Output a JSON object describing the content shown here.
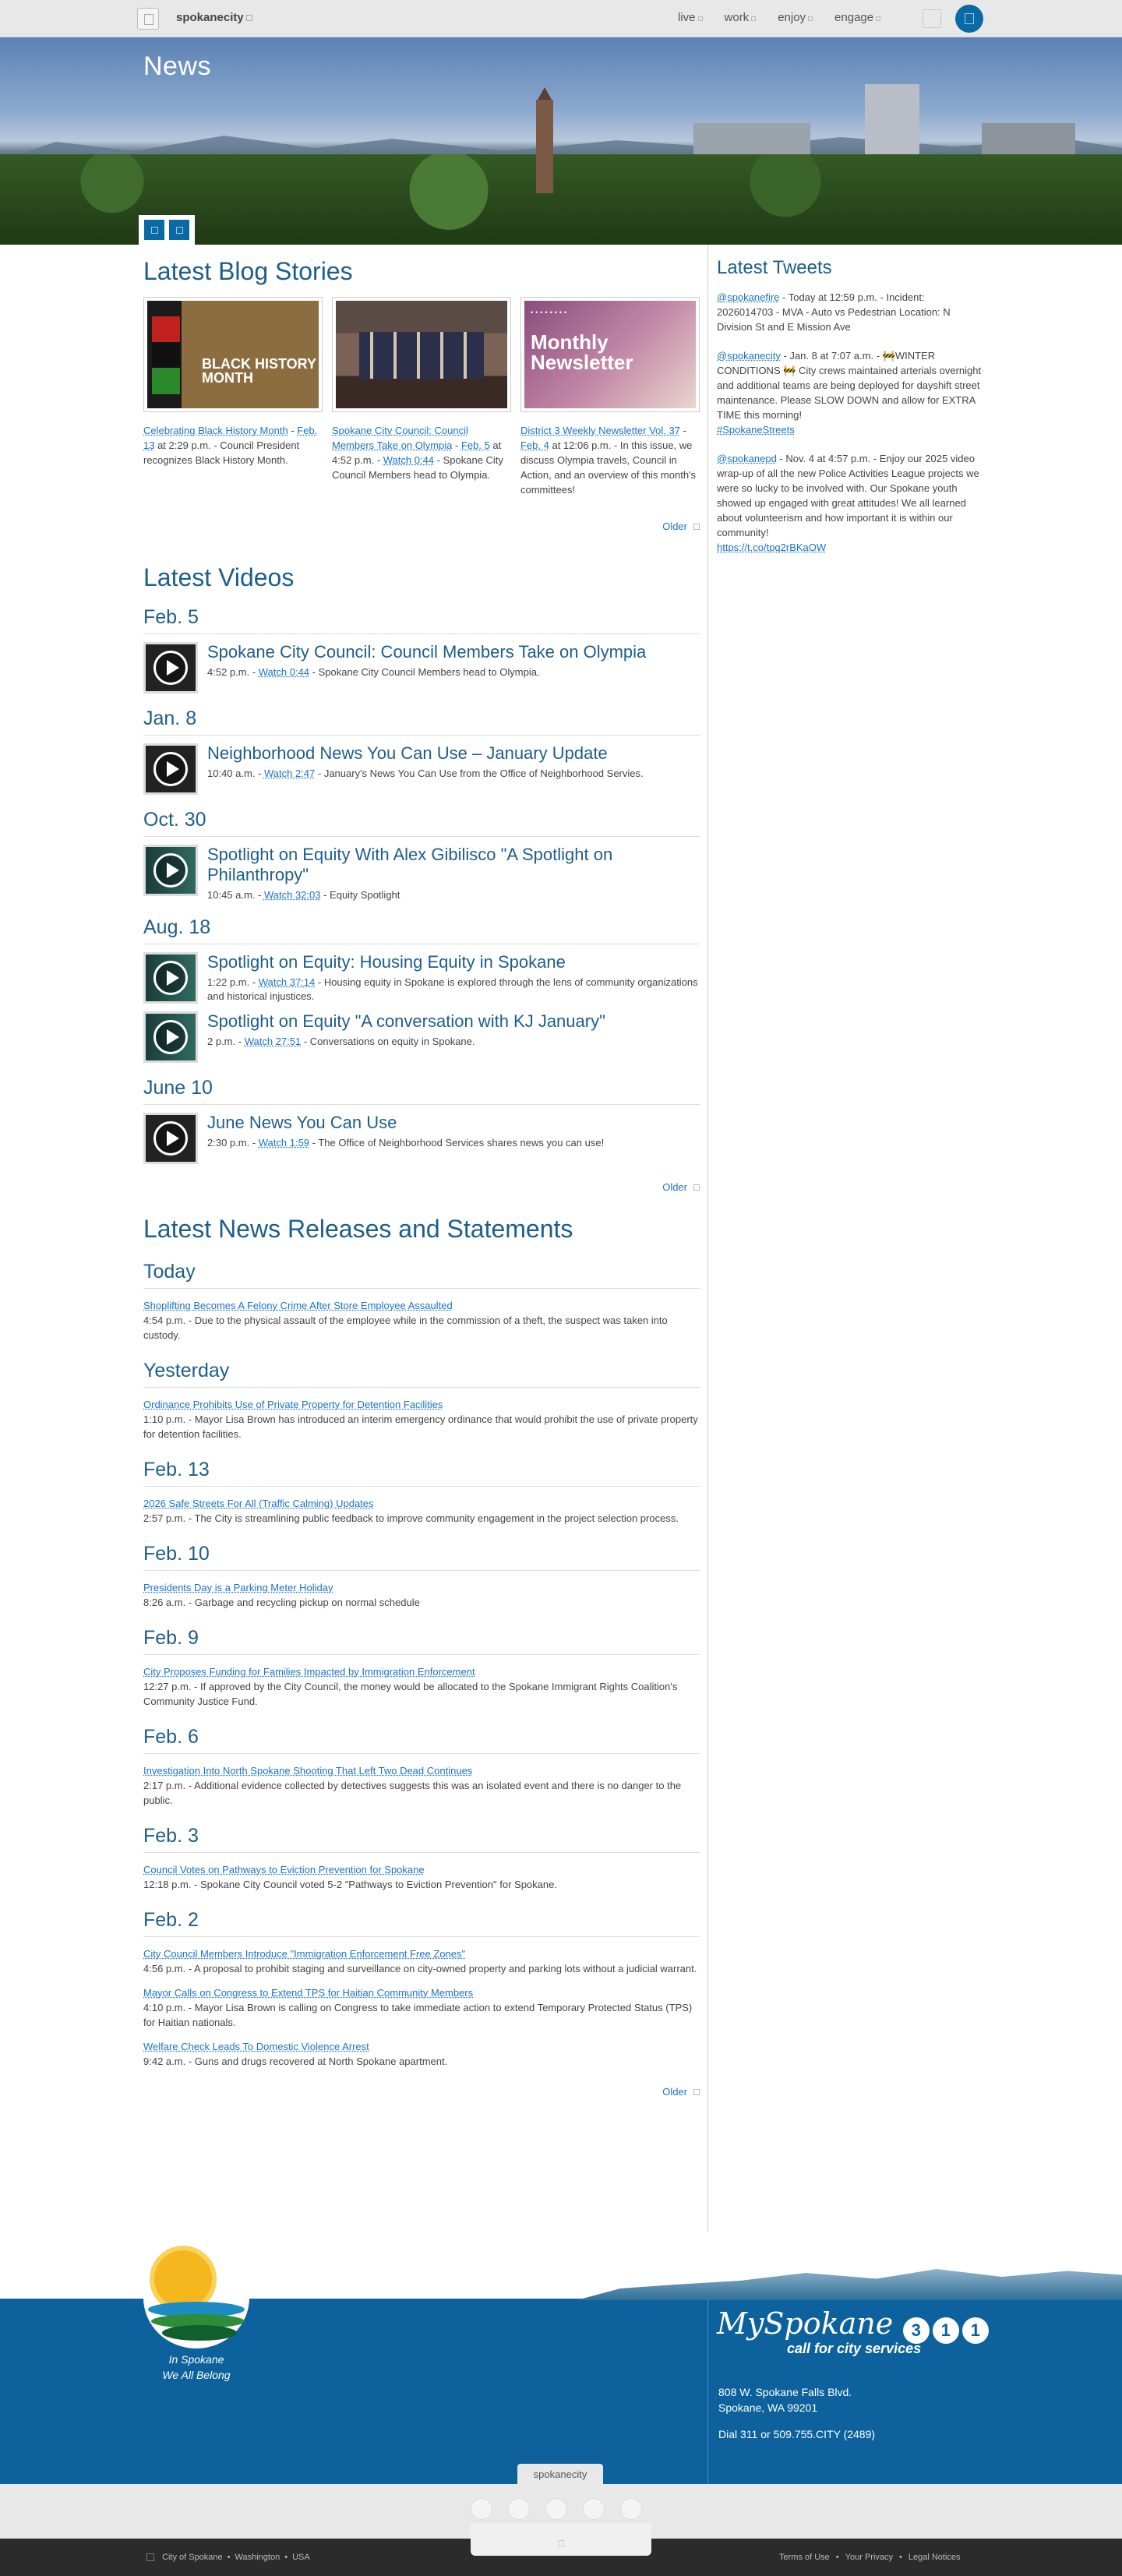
{
  "nav": {
    "brand": "spokanecity",
    "links": [
      "live",
      "work",
      "enjoy",
      "engage"
    ]
  },
  "hero": {
    "title": "News"
  },
  "blog": {
    "heading": "Latest Blog Stories",
    "cards": [
      {
        "image_text": "BLACK HISTORY MONTH",
        "title": "Celebrating Black History Month",
        "date": "Feb. 13",
        "time": " at 2:29 p.m.",
        "desc": " - Council President recognizes Black History Month."
      },
      {
        "image_text": "",
        "title": "Spokane City Council: Council Members Take on Olympia",
        "date": "Feb. 5",
        "time": " at 4:52 p.m.",
        "watch": "Watch 0:44",
        "desc": " - Spokane City Council Members head to Olympia."
      },
      {
        "image_text": "Monthly Newsletter",
        "title": "District 3 Weekly Newsletter Vol. 37",
        "date": "Feb. 4",
        "time": " at 12:06 p.m.",
        "desc": " - In this issue, we discuss Olympia travels, Council in Action, and an overview of this month's committees!"
      }
    ],
    "older": "Older"
  },
  "videos": {
    "heading": "Latest Videos",
    "groups": [
      {
        "date": "Feb. 5",
        "items": [
          {
            "title": "Spokane City Council: Council Members Take on Olympia",
            "time": "4:52 p.m. - ",
            "watch": "Watch 0:44",
            "desc": " - Spokane City Council Members head to Olympia."
          }
        ]
      },
      {
        "date": "Jan. 8",
        "items": [
          {
            "title": "Neighborhood News You Can Use – January Update",
            "time": "10:40 a.m. - ",
            "watch": "Watch 2:47",
            "desc": " - January's News You Can Use from the Office of Neighborhood Servies."
          }
        ]
      },
      {
        "date": "Oct. 30",
        "items": [
          {
            "title": "Spotlight on Equity With Alex Gibilisco \"A Spotlight on Philanthropy\"",
            "time": "10:45 a.m. - ",
            "watch": "Watch 32:03",
            "desc": " - Equity Spotlight"
          }
        ]
      },
      {
        "date": "Aug. 18",
        "items": [
          {
            "title": "Spotlight on Equity: Housing Equity in Spokane",
            "time": "1:22 p.m. - ",
            "watch": "Watch 37:14",
            "desc": " - Housing equity in Spokane is explored through the lens of community organizations and historical injustices."
          },
          {
            "title": "Spotlight on Equity \"A conversation with KJ January\"",
            "time": "2 p.m. - ",
            "watch": "Watch 27:51",
            "desc": " - Conversations on equity in Spokane."
          }
        ]
      },
      {
        "date": "June 10",
        "items": [
          {
            "title": "June News You Can Use",
            "time": "2:30 p.m. - ",
            "watch": "Watch 1:59",
            "desc": " - The Office of Neighborhood Services shares news you can use!"
          }
        ]
      }
    ],
    "older": "Older"
  },
  "news": {
    "heading": "Latest News Releases and Statements",
    "groups": [
      {
        "date": "Today",
        "items": [
          {
            "title": "Shoplifting Becomes A Felony Crime After Store Employee Assaulted",
            "desc": "4:54 p.m. - Due to the physical assault of the employee while in the commission of a theft, the suspect was taken into custody."
          }
        ]
      },
      {
        "date": "Yesterday",
        "items": [
          {
            "title": "Ordinance Prohibits Use of Private Property for Detention Facilities",
            "desc": "1:10 p.m. - Mayor Lisa Brown has introduced an interim emergency ordinance that would prohibit the use of private property for detention facilities."
          }
        ]
      },
      {
        "date": "Feb. 13",
        "items": [
          {
            "title": "2026 Safe Streets For All (Traffic Calming) Updates",
            "desc": "2:57 p.m. - The City is streamlining public feedback to improve community engagement in the project selection process."
          }
        ]
      },
      {
        "date": "Feb. 10",
        "items": [
          {
            "title": "Presidents Day is a Parking Meter Holiday",
            "desc": "8:26 a.m. - Garbage and recycling pickup on normal schedule"
          }
        ]
      },
      {
        "date": "Feb. 9",
        "items": [
          {
            "title": "City Proposes Funding for Families Impacted by Immigration Enforcement",
            "desc": "12:27 p.m. - If approved by the City Council, the money would be allocated to the Spokane Immigrant Rights Coalition's Community Justice Fund."
          }
        ]
      },
      {
        "date": "Feb. 6",
        "items": [
          {
            "title": "Investigation Into North Spokane Shooting That Left Two Dead Continues",
            "desc": "2:17 p.m. - Additional evidence collected by detectives suggests this was an isolated event and there is no danger to the public."
          }
        ]
      },
      {
        "date": "Feb. 3",
        "items": [
          {
            "title": "Council Votes on Pathways to Eviction Prevention for Spokane",
            "desc": "12:18 p.m. - Spokane City Council voted 5-2 \"Pathways to Eviction Prevention\" for Spokane."
          }
        ]
      },
      {
        "date": "Feb. 2",
        "items": [
          {
            "title": "City Council Members Introduce \"Immigration Enforcement Free Zones\"",
            "desc": "4:56 p.m. - A proposal to prohibit staging and surveillance on city-owned property and parking lots without a judicial warrant."
          },
          {
            "title": "Mayor Calls on Congress to Extend TPS for Haitian Community Members",
            "desc": "4:10 p.m. - Mayor Lisa Brown is calling on Congress to take immediate action to extend Temporary Protected Status (TPS) for Haitian nationals."
          },
          {
            "title": "Welfare Check Leads To Domestic Violence Arrest",
            "desc": "9:42 a.m. - Guns and drugs recovered at North Spokane apartment."
          }
        ]
      }
    ],
    "older": "Older"
  },
  "tweets": {
    "heading": "Latest Tweets",
    "items": [
      {
        "handle": "@spokanefire",
        "text": " - Today at 12:59 p.m. - Incident: 2026014703 - MVA - Auto vs Pedestrian Location: N Division St and E Mission Ave"
      },
      {
        "handle": "@spokanecity",
        "text": " - Jan. 8 at 7:07 a.m. - 🚧WINTER CONDITIONS 🚧 City crews maintained arterials overnight and additional teams are being deployed for dayshift street maintenance. Please SLOW DOWN and allow for EXTRA TIME this morning!",
        "tag": "#SpokaneStreets"
      },
      {
        "handle": "@spokanepd",
        "text": " - Nov. 4 at 4:57 p.m. - Enjoy our 2025 video wrap-up of all the new Police Activities League projects we were so lucky to be involved with. Our Spokane youth showed up engaged with great attitudes! We all learned about volunteerism and how important it is within our community!",
        "tag": "https://t.co/tpq2rBKaOW"
      }
    ]
  },
  "footer": {
    "slogan_1": "In Spokane",
    "slogan_2": "We All Belong",
    "my": "MySpokane",
    "num": [
      "3",
      "1",
      "1"
    ],
    "call": "call for city services",
    "address_1": "808 W. Spokane Falls Blvd.",
    "address_2": "Spokane, WA 99201",
    "phone": "Dial 311 or 509.755.CITY (2489)",
    "tab": "spokanecity",
    "legal_left": [
      "City of Spokane",
      "•",
      "Washington",
      "•",
      "USA"
    ],
    "legal_right": [
      "Terms of Use",
      "•",
      "Your Privacy",
      "•",
      "Legal Notices"
    ]
  }
}
